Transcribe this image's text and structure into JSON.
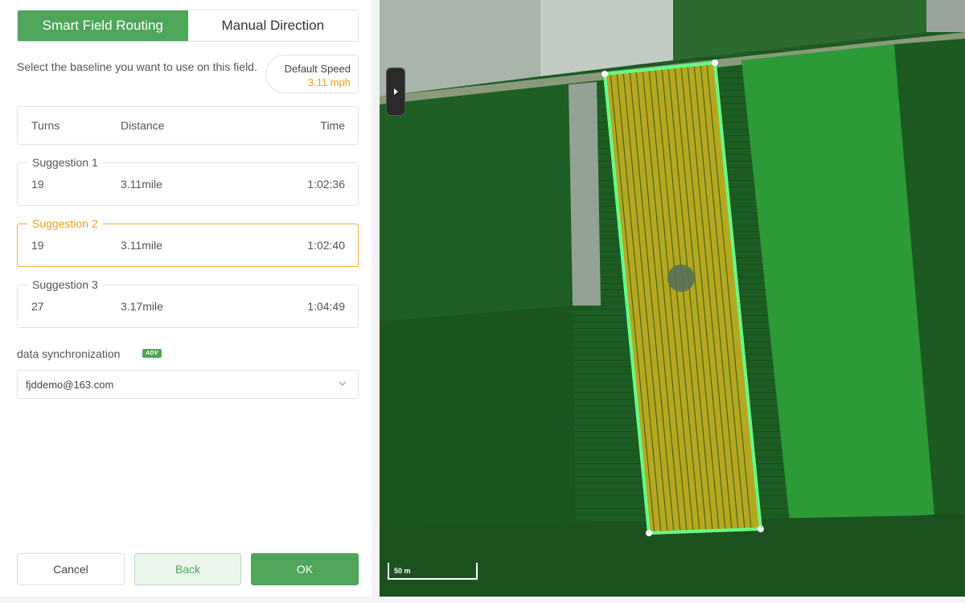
{
  "tabs": {
    "smart": "Smart Field Routing",
    "manual": "Manual Direction"
  },
  "baseline_prompt": "Select the baseline you want to use on this field.",
  "speed": {
    "label": "Default Speed",
    "value": "3.11 mph"
  },
  "table_header": {
    "turns": "Turns",
    "distance": "Distance",
    "time": "Time"
  },
  "suggestions": [
    {
      "title": "Suggestion 1",
      "turns": "19",
      "distance": "3.11mile",
      "time": "1:02:36"
    },
    {
      "title": "Suggestion 2",
      "turns": "19",
      "distance": "3.11mile",
      "time": "1:02:40",
      "selected": true
    },
    {
      "title": "Suggestion 3",
      "turns": "27",
      "distance": "3.17mile",
      "time": "1:04:49"
    }
  ],
  "sync": {
    "label": "data synchronization",
    "badge": "ADV",
    "selected_account": "fjddemo@163.com"
  },
  "buttons": {
    "cancel": "Cancel",
    "back": "Back",
    "ok": "OK"
  },
  "map": {
    "scale_label": "50 m",
    "field_boundary_color": "#66ff88",
    "route_color": "#d8c020"
  },
  "colors": {
    "accent": "#4fa55a",
    "highlight": "#f0a020"
  },
  "icons": {
    "panel_toggle": "chevron-right-icon",
    "dropdown": "chevron-down-icon"
  }
}
